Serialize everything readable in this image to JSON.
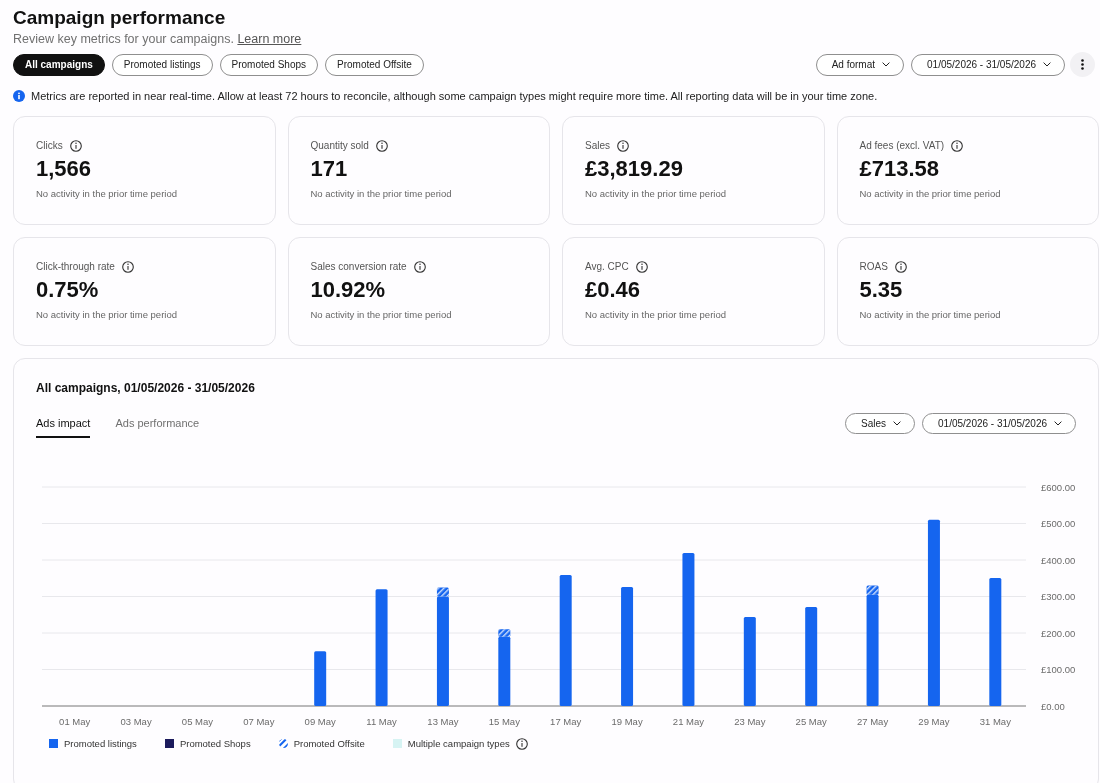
{
  "header": {
    "title": "Campaign performance",
    "subtitle": "Review key metrics for your campaigns.",
    "link": "Learn more"
  },
  "filters": [
    {
      "label": "All campaigns",
      "selected": true
    },
    {
      "label": "Promoted listings",
      "selected": false
    },
    {
      "label": "Promoted Shops",
      "selected": false
    },
    {
      "label": "Promoted Offsite",
      "selected": false
    }
  ],
  "toolbar": {
    "dropdowns": [
      {
        "label": "Ad format"
      },
      {
        "label": "01/05/2026 - 31/05/2026"
      }
    ]
  },
  "notice": "Metrics are reported in near real-time. Allow at least 72 hours to reconcile, although some campaign types might require more time. All reporting data will be in your time zone.",
  "metrics": [
    {
      "label": "Clicks",
      "value": "1,566",
      "note": "No activity in the prior time period"
    },
    {
      "label": "Quantity sold",
      "value": "171",
      "note": "No activity in the prior time period"
    },
    {
      "label": "Sales",
      "value": "£3,819.29",
      "note": "No activity in the prior time period"
    },
    {
      "label": "Ad fees (excl. VAT)",
      "value": "£713.58",
      "note": "No activity in the prior time period"
    },
    {
      "label": "Click-through rate",
      "value": "0.75%",
      "note": "No activity in the prior time period"
    },
    {
      "label": "Sales conversion rate",
      "value": "10.92%",
      "note": "No activity in the prior time period"
    },
    {
      "label": "Avg. CPC",
      "value": "£0.46",
      "note": "No activity in the prior time period"
    },
    {
      "label": "ROAS",
      "value": "5.35",
      "note": "No activity in the prior time period"
    }
  ],
  "chart_panel": {
    "title": "All campaigns, 01/05/2026 - 31/05/2026",
    "tabs": [
      {
        "label": "Ads impact",
        "selected": true
      },
      {
        "label": "Ads performance",
        "selected": false
      }
    ],
    "dropdowns": [
      {
        "label": "Sales"
      },
      {
        "label": "01/05/2026 - 31/05/2026"
      }
    ],
    "series_styles": [
      {
        "kind": "solid",
        "info": false
      },
      {
        "kind": "solid",
        "info": false
      },
      {
        "kind": "hatched",
        "info": false
      },
      {
        "kind": "solid",
        "info": true
      }
    ],
    "chart_data": [
      {
        "type": "bar",
        "stacked": true,
        "grid": true,
        "legend": "bottom",
        "categories": [
          "01 May",
          "03 May",
          "05 May",
          "07 May",
          "09 May",
          "11 May",
          "13 May",
          "15 May",
          "17 May",
          "19 May",
          "21 May",
          "23 May",
          "25 May",
          "27 May",
          "29 May",
          "31 May"
        ],
        "ylim": [
          0,
          600
        ],
        "yticks": [
          {
            "value": 0,
            "label": "£0.00"
          },
          {
            "value": 100,
            "label": "£100.00"
          },
          {
            "value": 200,
            "label": "£200.00"
          },
          {
            "value": 300,
            "label": "£300.00"
          },
          {
            "value": 400,
            "label": "£400.00"
          },
          {
            "value": 500,
            "label": "£500.00"
          },
          {
            "value": 600,
            "label": "£600.00"
          }
        ],
        "series": [
          {
            "name": "Promoted listings",
            "color": "#1565ef",
            "values": [
              0,
              0,
              0,
              0,
              150,
              320,
              300,
              190,
              359,
              326,
              419,
              244,
              271,
              305,
              510,
              351
            ]
          },
          {
            "name": "Promoted Shops",
            "color": "#1b1a5c",
            "values": [
              0,
              0,
              0,
              0,
              0,
              0,
              0,
              0,
              0,
              0,
              0,
              0,
              0,
              0,
              0,
              0
            ]
          },
          {
            "name": "Promoted Offsite",
            "color": "#1565ef",
            "values": [
              0,
              0,
              0,
              0,
              0,
              0,
              25,
              20,
              0,
              0,
              0,
              0,
              0,
              25,
              0,
              0
            ]
          },
          {
            "name": "Multiple campaign types",
            "color": "#d6f3f3",
            "values": [
              0,
              0,
              0,
              0,
              0,
              0,
              0,
              0,
              0,
              0,
              0,
              0,
              0,
              0,
              0,
              0
            ]
          }
        ]
      }
    ]
  }
}
